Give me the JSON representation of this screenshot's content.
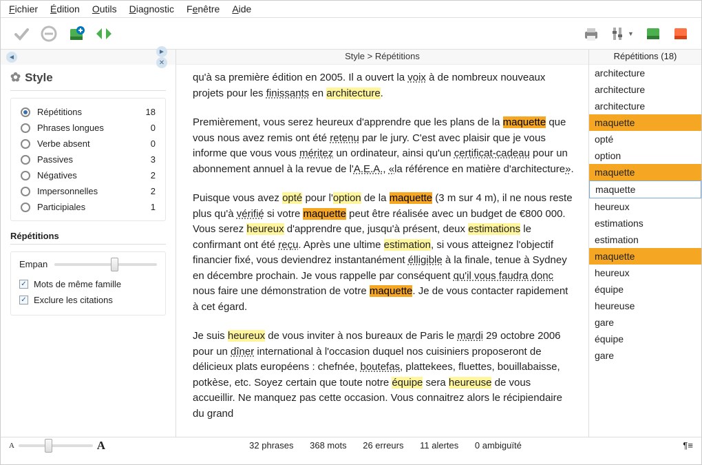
{
  "menu": [
    "Fichier",
    "Édition",
    "Outils",
    "Diagnostic",
    "Fenêtre",
    "Aide"
  ],
  "breadcrumb": "Style  >  Répétitions",
  "panel_title": "Style",
  "style_options": [
    {
      "label": "Répétitions",
      "count": 18,
      "selected": true
    },
    {
      "label": "Phrases longues",
      "count": 0,
      "selected": false
    },
    {
      "label": "Verbe absent",
      "count": 0,
      "selected": false
    },
    {
      "label": "Passives",
      "count": 3,
      "selected": false
    },
    {
      "label": "Négatives",
      "count": 2,
      "selected": false
    },
    {
      "label": "Impersonnelles",
      "count": 2,
      "selected": false
    },
    {
      "label": "Participiales",
      "count": 1,
      "selected": false
    }
  ],
  "options": {
    "title": "Répétitions",
    "empan_label": "Empan",
    "check1": "Mots de même famille",
    "check2": "Exclure les citations"
  },
  "right_title": "Répétitions (18)",
  "words": [
    {
      "w": "architecture",
      "c": ""
    },
    {
      "w": "architecture",
      "c": ""
    },
    {
      "w": "architecture",
      "c": ""
    },
    {
      "w": "maquette",
      "c": "orange"
    },
    {
      "w": "opté",
      "c": ""
    },
    {
      "w": "option",
      "c": ""
    },
    {
      "w": "maquette",
      "c": "orange"
    },
    {
      "w": "maquette",
      "c": "selected"
    },
    {
      "w": "heureux",
      "c": ""
    },
    {
      "w": "estimations",
      "c": ""
    },
    {
      "w": "estimation",
      "c": ""
    },
    {
      "w": "maquette",
      "c": "orange"
    },
    {
      "w": "heureux",
      "c": ""
    },
    {
      "w": "équipe",
      "c": ""
    },
    {
      "w": "heureuse",
      "c": ""
    },
    {
      "w": "gare",
      "c": ""
    },
    {
      "w": "équipe",
      "c": ""
    },
    {
      "w": "gare",
      "c": ""
    }
  ],
  "status": {
    "phrases": "32 phrases",
    "mots": "368 mots",
    "erreurs": "26 erreurs",
    "alertes": "11 alertes",
    "ambig": "0 ambiguïté"
  }
}
